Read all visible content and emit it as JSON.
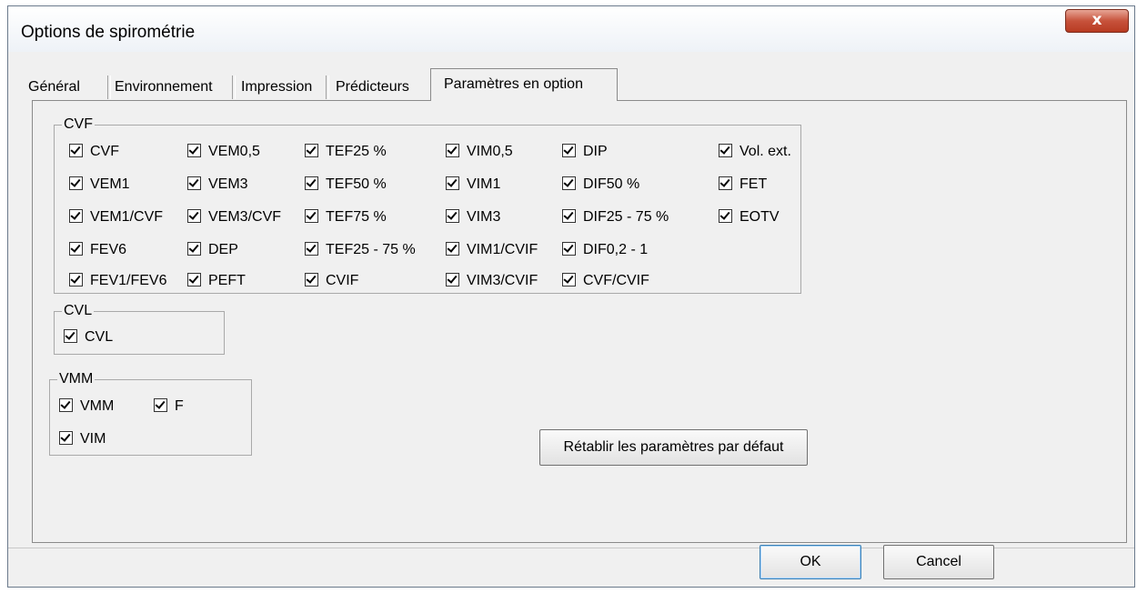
{
  "window": {
    "title": "Options de spirométrie",
    "close_label": "x"
  },
  "tabs": [
    "Général",
    "Environnement",
    "Impression",
    "Prédicteurs"
  ],
  "active_tab": "Paramètres en option",
  "cvf_group": {
    "legend": "CVF",
    "items": [
      "CVF",
      "VEM1",
      "VEM1/CVF",
      "FEV6",
      "FEV1/FEV6",
      "VEM0,5",
      "VEM3",
      "VEM3/CVF",
      "DEP",
      "PEFT",
      "TEF25 %",
      "TEF50 %",
      "TEF75 %",
      "TEF25 - 75 %",
      "CVIF",
      "VIM0,5",
      "VIM1",
      "VIM3",
      "VIM1/CVIF",
      "VIM3/CVIF",
      "DIP",
      "DIF50 %",
      "DIF25 - 75 %",
      "DIF0,2 - 1",
      "CVF/CVIF",
      "Vol. ext.",
      "FET",
      "EOTV"
    ]
  },
  "cvl_group": {
    "legend": "CVL",
    "items": [
      "CVL"
    ]
  },
  "vmm_group": {
    "legend": "VMM",
    "items": [
      "VMM",
      "F",
      "VIM"
    ]
  },
  "buttons": {
    "reset": "Rétablir les paramètres par défaut",
    "ok": "OK",
    "cancel": "Cancel"
  }
}
